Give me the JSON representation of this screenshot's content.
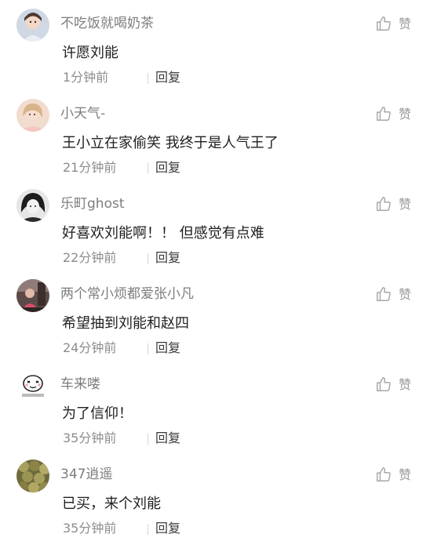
{
  "comments": [
    {
      "username": "不吃饭就喝奶茶",
      "text": "许愿刘能",
      "time": "1分钟前",
      "reply_label": "回复",
      "like_label": "赞",
      "avatar_icon": "girl-portrait-avatar"
    },
    {
      "username": "小天气-",
      "text": "王小立在家偷笑 我终于是人气王了",
      "time": "21分钟前",
      "reply_label": "回复",
      "like_label": "赞",
      "avatar_icon": "girl-blonde-avatar"
    },
    {
      "username": "乐町ghost",
      "text": "好喜欢刘能啊！！ 但感觉有点难",
      "time": "22分钟前",
      "reply_label": "回复",
      "like_label": "赞",
      "avatar_icon": "dark-hair-avatar"
    },
    {
      "username": "两个常小烦都爱张小凡",
      "text": "希望抽到刘能和赵四",
      "time": "24分钟前",
      "reply_label": "回复",
      "like_label": "赞",
      "avatar_icon": "scene-photo-avatar"
    },
    {
      "username": "车来喽",
      "text": "为了信仰！",
      "time": "35分钟前",
      "reply_label": "回复",
      "like_label": "赞",
      "avatar_icon": "cartoon-face-avatar"
    },
    {
      "username": "347逍遥",
      "text": "已买，来个刘能",
      "time": "35分钟前",
      "reply_label": "回复",
      "like_label": "赞",
      "avatar_icon": "coins-avatar"
    }
  ]
}
